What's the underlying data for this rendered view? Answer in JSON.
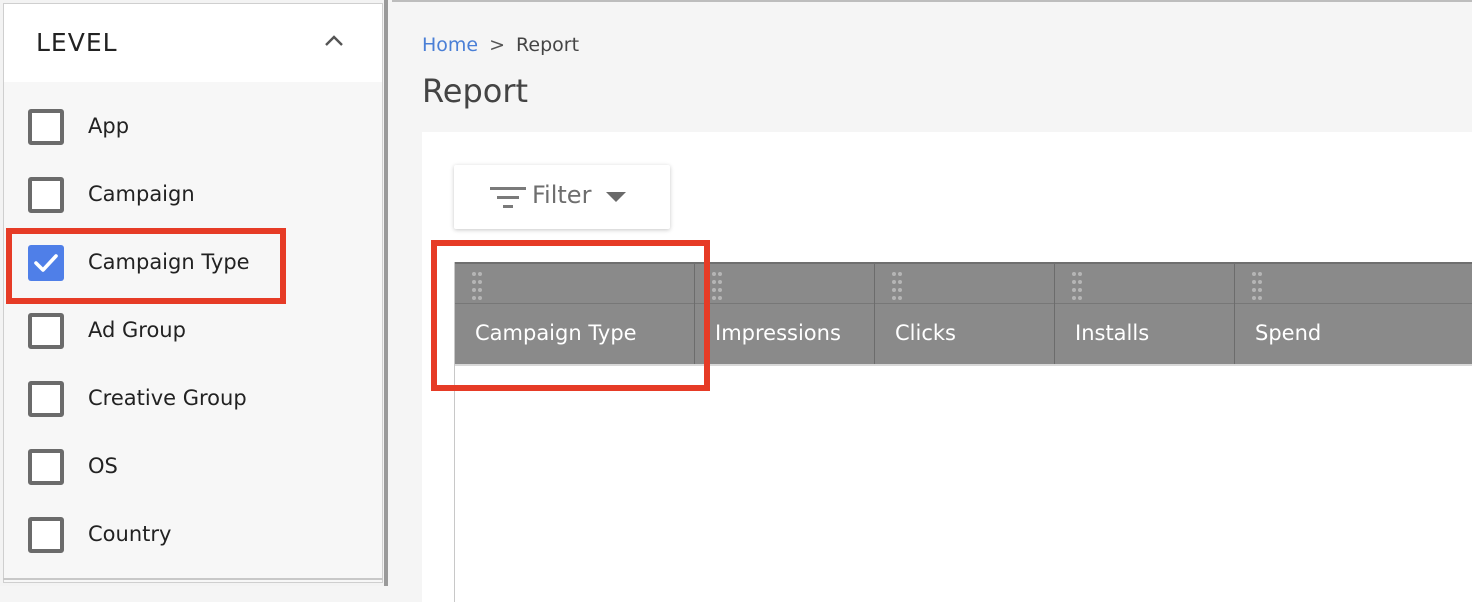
{
  "sidebar": {
    "title": "LEVEL",
    "items": [
      {
        "label": "App",
        "checked": false
      },
      {
        "label": "Campaign",
        "checked": false
      },
      {
        "label": "Campaign Type",
        "checked": true
      },
      {
        "label": "Ad Group",
        "checked": false
      },
      {
        "label": "Creative Group",
        "checked": false
      },
      {
        "label": "OS",
        "checked": false
      },
      {
        "label": "Country",
        "checked": false
      }
    ]
  },
  "breadcrumb": {
    "home": "Home",
    "separator": ">",
    "current": "Report"
  },
  "page": {
    "title": "Report"
  },
  "toolbar": {
    "filter_label": "Filter"
  },
  "grid": {
    "columns": [
      "Campaign Type",
      "Impressions",
      "Clicks",
      "Installs",
      "Spend"
    ]
  },
  "colors": {
    "accent": "#4f7fe8",
    "link": "#4a7fd6",
    "header_bg": "#8a8a8a",
    "highlight": "#e63b26"
  }
}
